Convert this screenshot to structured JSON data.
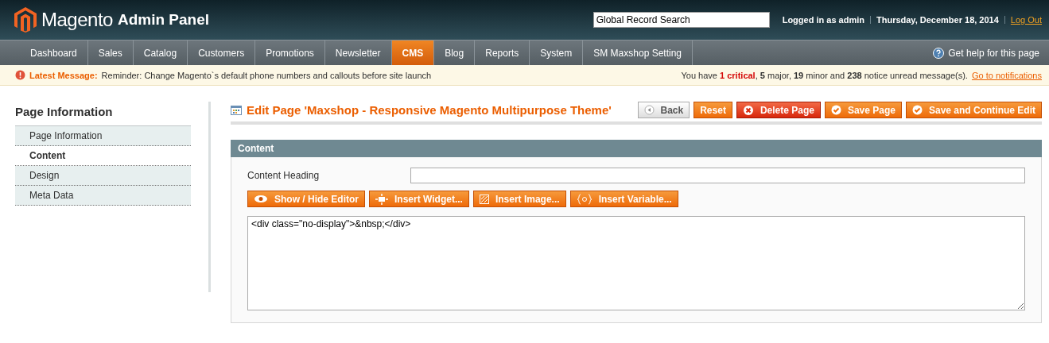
{
  "header": {
    "logo": "Magento",
    "logo_suffix": "Admin Panel",
    "search": {
      "value": "Global Record Search"
    },
    "user": "Logged in as admin",
    "date": "Thursday, December 18, 2014",
    "logout": "Log Out"
  },
  "nav": {
    "items": [
      {
        "label": "Dashboard",
        "selected": false
      },
      {
        "label": "Sales",
        "selected": false
      },
      {
        "label": "Catalog",
        "selected": false
      },
      {
        "label": "Customers",
        "selected": false
      },
      {
        "label": "Promotions",
        "selected": false
      },
      {
        "label": "Newsletter",
        "selected": false
      },
      {
        "label": "CMS",
        "selected": true
      },
      {
        "label": "Blog",
        "selected": false
      },
      {
        "label": "Reports",
        "selected": false
      },
      {
        "label": "System",
        "selected": false
      },
      {
        "label": "SM Maxshop Setting",
        "selected": false
      }
    ],
    "help": "Get help for this page"
  },
  "message_bar": {
    "label": "Latest Message:",
    "text": "Reminder: Change Magento`s default phone numbers and callouts before site launch",
    "notice": "You have **1 critical**, **5** major, **19** minor and **238** notice unread message(s).",
    "link": "Go to notifications"
  },
  "sidebar": {
    "title": "Page Information",
    "items": [
      {
        "label": "Page Information",
        "selected": false
      },
      {
        "label": "Content",
        "selected": true
      },
      {
        "label": "Design",
        "selected": false
      },
      {
        "label": "Meta Data",
        "selected": false
      }
    ]
  },
  "page": {
    "title": "Edit Page 'Maxshop - Responsive Magento Multipurpose Theme'",
    "buttons": [
      {
        "label": "Back",
        "kind": "back"
      },
      {
        "label": "Reset",
        "kind": "plain"
      },
      {
        "label": "Delete Page",
        "kind": "delete"
      },
      {
        "label": "Save Page",
        "kind": "save"
      },
      {
        "label": "Save and Continue Edit",
        "kind": "save"
      }
    ]
  },
  "section": {
    "title": "Content",
    "field_label": "Content Heading",
    "editor_buttons": [
      {
        "label": "Show / Hide Editor",
        "kind": "eye"
      },
      {
        "label": "Insert Widget...",
        "kind": "widget"
      },
      {
        "label": "Insert Image...",
        "kind": "image"
      },
      {
        "label": "Insert Variable...",
        "kind": "variable"
      }
    ],
    "editor_value": "<div class=\"no-display\">&nbsp;</div>"
  }
}
